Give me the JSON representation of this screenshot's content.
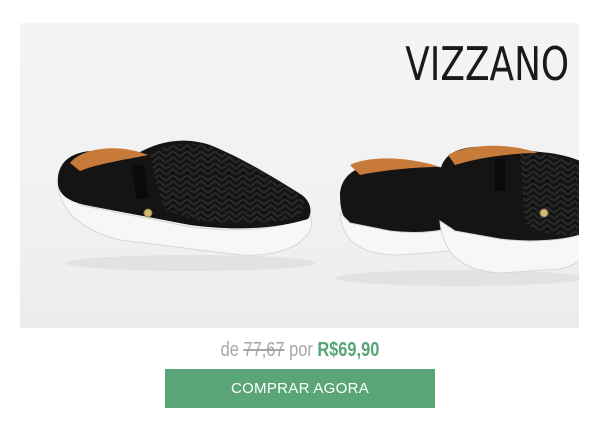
{
  "brand": {
    "logo_text": "VIZZANO"
  },
  "price": {
    "prefix": "de",
    "old_price": "77,67",
    "connector": "por",
    "new_price": "R$69,90"
  },
  "cta": {
    "label": "COMPRAR AGORA"
  },
  "colors": {
    "accent": "#5aa678",
    "muted_text": "#a6a6a6",
    "shoe": "#141414",
    "sole": "#f7f7f7"
  }
}
